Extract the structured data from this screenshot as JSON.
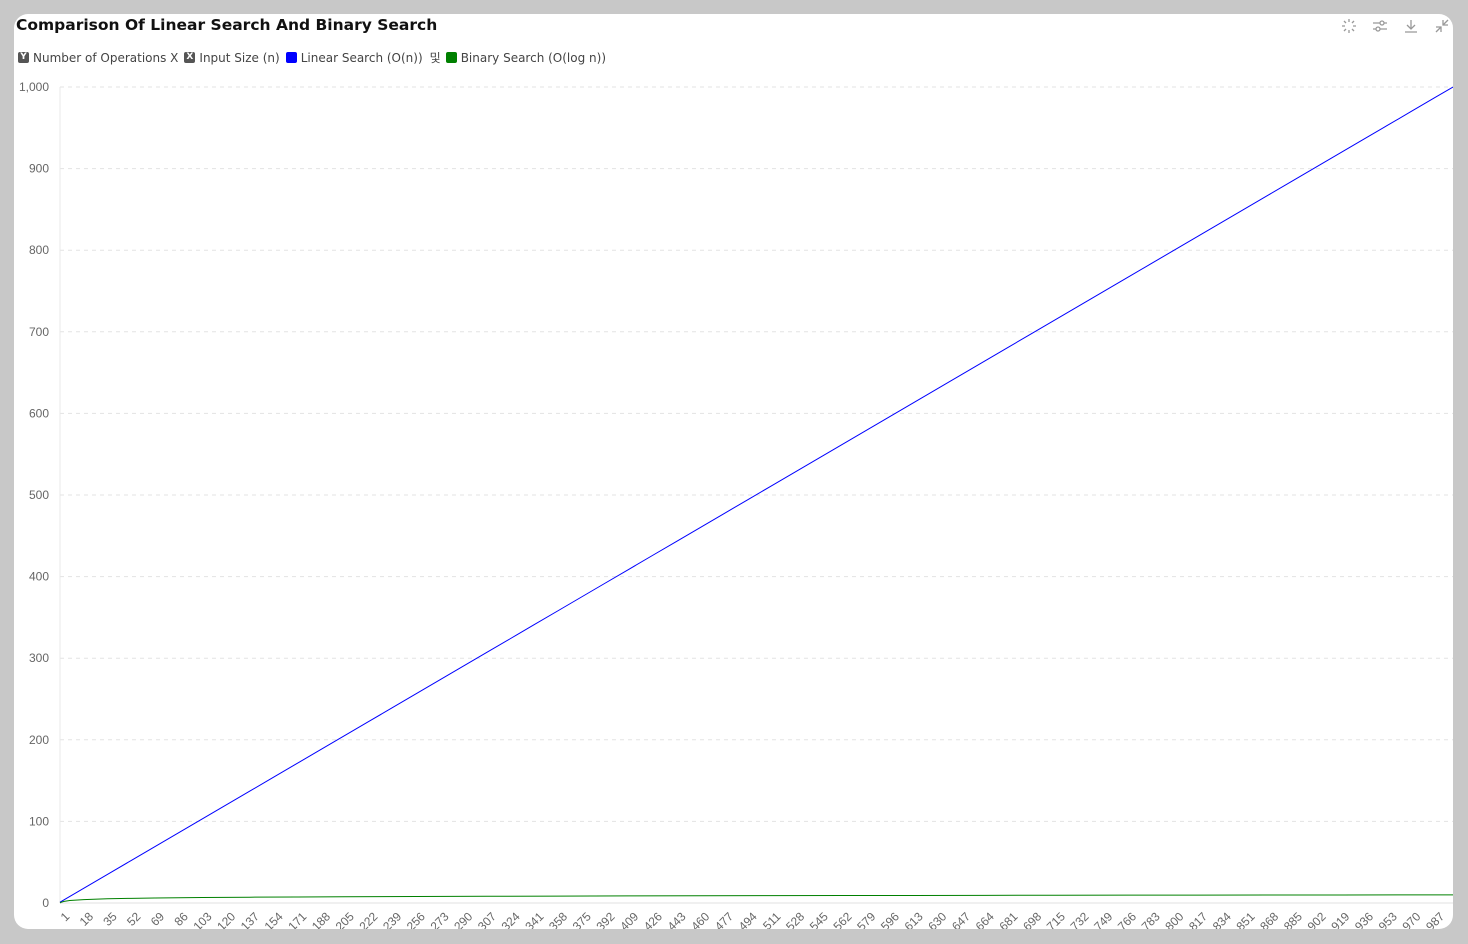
{
  "title": "Comparison Of Linear Search And Binary Search",
  "toolbar": [
    {
      "name": "magic-select-icon"
    },
    {
      "name": "settings-sliders-icon"
    },
    {
      "name": "download-icon"
    },
    {
      "name": "collapse-icon"
    }
  ],
  "legend": {
    "y_badge": "Y",
    "y_label": "Number of Operations X",
    "x_badge": "X",
    "x_label": "Input Size (n)",
    "separator": "및",
    "series": [
      {
        "label": "Linear Search (O(n))",
        "color": "#0000ff"
      },
      {
        "label": "Binary Search (O(log n))",
        "color": "#008000"
      }
    ]
  },
  "chart_data": {
    "type": "line",
    "title": "Comparison Of Linear Search And Binary Search",
    "xlabel": "Input Size (n)",
    "ylabel": "Number of Operations",
    "x_start": 1,
    "x_end": 1000,
    "x_tick_labels": [
      "1",
      "18",
      "35",
      "52",
      "69",
      "86",
      "103",
      "120",
      "137",
      "154",
      "171",
      "188",
      "205",
      "222",
      "239",
      "256",
      "273",
      "290",
      "307",
      "324",
      "341",
      "358",
      "375",
      "392",
      "409",
      "426",
      "443",
      "460",
      "477",
      "494",
      "511",
      "528",
      "545",
      "562",
      "579",
      "596",
      "613",
      "630",
      "647",
      "664",
      "681",
      "698",
      "715",
      "732",
      "749",
      "766",
      "783",
      "800",
      "817",
      "834",
      "851",
      "868",
      "885",
      "902",
      "919",
      "936",
      "953",
      "970",
      "987"
    ],
    "y_ticks": [
      "0",
      "100",
      "200",
      "300",
      "400",
      "500",
      "600",
      "700",
      "800",
      "900",
      "1,000"
    ],
    "ylim": [
      0,
      1000
    ],
    "grid": "horizontal dashed",
    "series": [
      {
        "name": "Linear Search (O(n))",
        "color": "#0000ff",
        "x": [
          1,
          18,
          35,
          52,
          69,
          86,
          103,
          120,
          137,
          154,
          171,
          188,
          205,
          222,
          239,
          256,
          273,
          290,
          307,
          324,
          341,
          358,
          375,
          392,
          409,
          426,
          443,
          460,
          477,
          494,
          511,
          528,
          545,
          562,
          579,
          596,
          613,
          630,
          647,
          664,
          681,
          698,
          715,
          732,
          749,
          766,
          783,
          800,
          817,
          834,
          851,
          868,
          885,
          902,
          919,
          936,
          953,
          970,
          987,
          1000
        ],
        "y": [
          1,
          18,
          35,
          52,
          69,
          86,
          103,
          120,
          137,
          154,
          171,
          188,
          205,
          222,
          239,
          256,
          273,
          290,
          307,
          324,
          341,
          358,
          375,
          392,
          409,
          426,
          443,
          460,
          477,
          494,
          511,
          528,
          545,
          562,
          579,
          596,
          613,
          630,
          647,
          664,
          681,
          698,
          715,
          732,
          749,
          766,
          783,
          800,
          817,
          834,
          851,
          868,
          885,
          902,
          919,
          936,
          953,
          970,
          987,
          1000
        ]
      },
      {
        "name": "Binary Search (O(log n))",
        "color": "#008000",
        "x": [
          1,
          2,
          4,
          8,
          18,
          35,
          52,
          69,
          86,
          103,
          137,
          171,
          205,
          256,
          307,
          358,
          409,
          460,
          511,
          562,
          613,
          664,
          715,
          766,
          817,
          868,
          919,
          970,
          1000
        ],
        "y": [
          0,
          1,
          2,
          3,
          4.17,
          5.13,
          5.7,
          6.11,
          6.43,
          6.69,
          7.1,
          7.42,
          7.68,
          8,
          8.26,
          8.48,
          8.68,
          8.85,
          9,
          9.13,
          9.26,
          9.38,
          9.48,
          9.58,
          9.67,
          9.76,
          9.84,
          9.92,
          9.97
        ]
      }
    ]
  }
}
